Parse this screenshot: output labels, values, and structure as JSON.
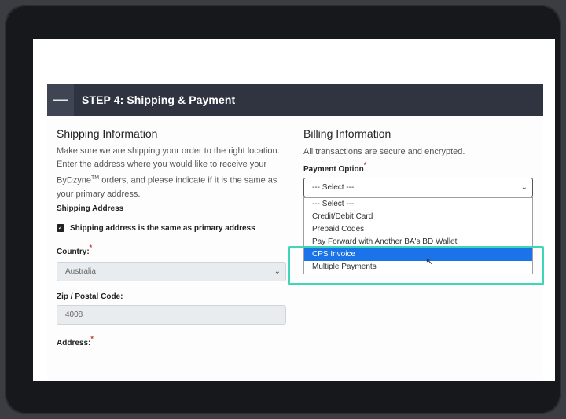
{
  "step": {
    "title": "STEP 4: Shipping & Payment",
    "collapse_symbol": "—"
  },
  "shipping": {
    "heading": "Shipping Information",
    "description_1": "Make sure we are shipping your order to the right location. Enter the address where you would like to receive your ByDzyne",
    "trademark": "TM",
    "description_2": " orders, and please indicate if it is the same as your primary address.",
    "address_label": "Shipping Address",
    "same_address_label": "Shipping address is the same as primary address",
    "same_address_checked": true,
    "country_label": "Country:",
    "country_value": "Australia",
    "zip_label": "Zip / Postal Code:",
    "zip_value": "4008",
    "address_field_label": "Address:"
  },
  "billing": {
    "heading": "Billing Information",
    "description": "All transactions are secure and encrypted.",
    "payment_label": "Payment Option",
    "payment_selected": "--- Select ---",
    "options": [
      "--- Select ---",
      "Credit/Debit Card",
      "Prepaid Codes",
      "Pay Forward with Another BA's BD Wallet",
      "CPS Invoice",
      "Multiple Payments"
    ],
    "highlighted_option": "CPS Invoice"
  },
  "icons": {
    "chevron": "chevron-down-icon",
    "checkbox": "check-icon",
    "cursor": "mouse-cursor-icon"
  },
  "colors": {
    "header_bg": "#2f3440",
    "highlight_color": "#3fd6b8",
    "selected_option_bg": "#1a73e8"
  },
  "req_mark": "*"
}
